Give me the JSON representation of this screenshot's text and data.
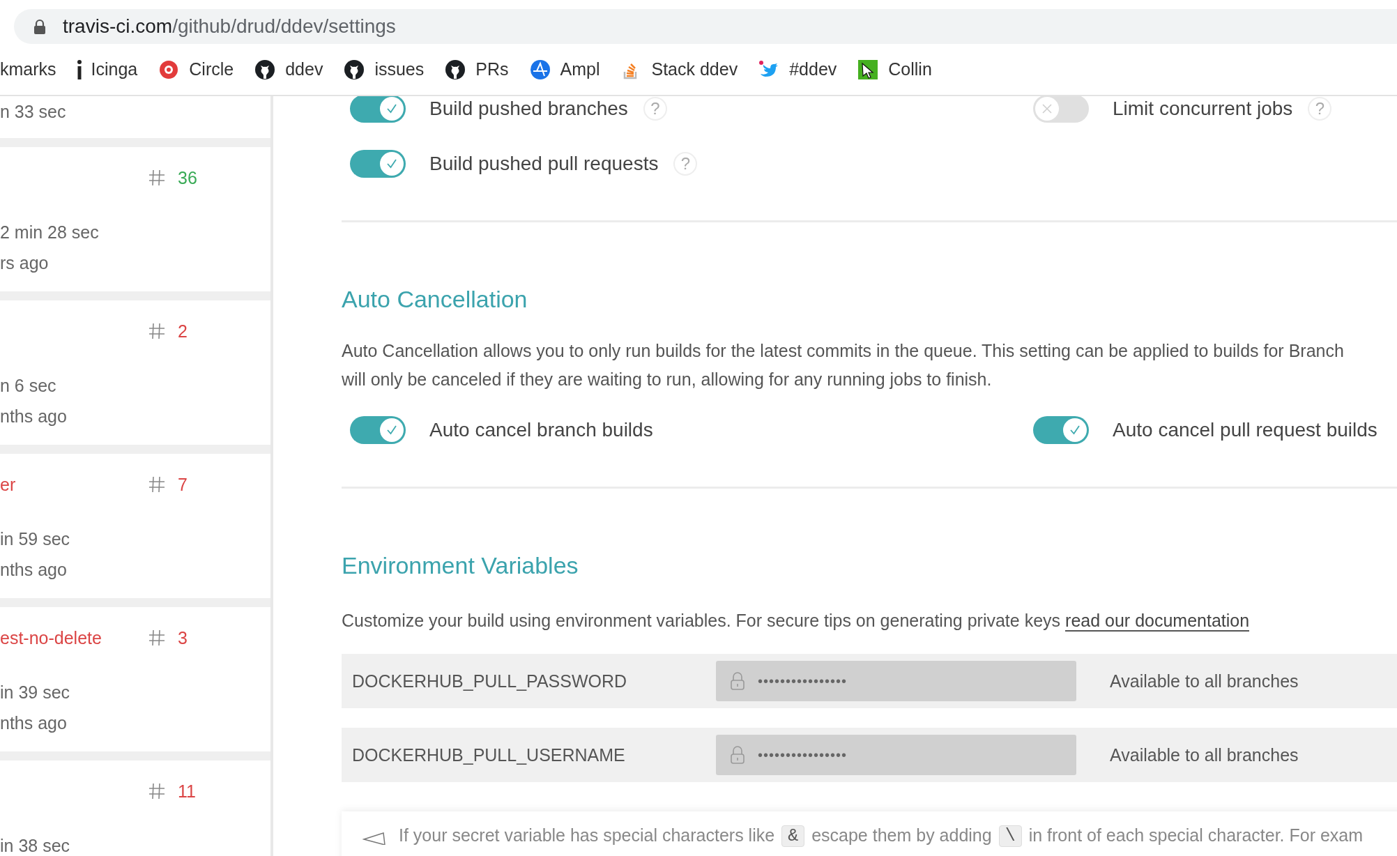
{
  "browser": {
    "url_host": "travis-ci.com",
    "url_path": "/github/drud/ddev/settings",
    "bookmarks": [
      {
        "kind": "none",
        "label": "kmarks"
      },
      {
        "kind": "info",
        "label": "Icinga"
      },
      {
        "kind": "ring",
        "label": "Circle"
      },
      {
        "kind": "cat",
        "label": "ddev"
      },
      {
        "kind": "cat",
        "label": "issues"
      },
      {
        "kind": "cat",
        "label": "PRs"
      },
      {
        "kind": "wave",
        "label": "Ampl"
      },
      {
        "kind": "stack",
        "label": "Stack ddev"
      },
      {
        "kind": "bird",
        "label": "#ddev"
      },
      {
        "kind": "cursor",
        "label": "Collin"
      }
    ]
  },
  "sidebar": {
    "builds": [
      {
        "duration": "n 33 sec"
      },
      {
        "color": "#39aa56",
        "number": "36",
        "duration": "2 min 28 sec",
        "age": "rs ago"
      },
      {
        "color": "#db4545",
        "number": "2",
        "duration": "n 6 sec",
        "age": "nths ago"
      },
      {
        "color": "#db4545",
        "branch": "er",
        "number": "7",
        "duration": "in 59 sec",
        "age": "nths ago"
      },
      {
        "color": "#db4545",
        "branch": "est-no-delete",
        "number": "3",
        "duration": "in 39 sec",
        "age": "nths ago"
      },
      {
        "color": "#db4545",
        "number": "11",
        "duration": "in 38 sec"
      }
    ]
  },
  "general": {
    "left": [
      {
        "label": "Build pushed branches",
        "on": true,
        "help": "?"
      },
      {
        "label": "Build pushed pull requests",
        "on": true,
        "help": "?"
      }
    ],
    "right": [
      {
        "label": "Limit concurrent jobs",
        "on": false,
        "help": "?"
      }
    ]
  },
  "auto_cancellation": {
    "title": "Auto Cancellation",
    "description_lines": [
      "Auto Cancellation allows you to only run builds for the latest commits in the queue. This setting can be applied to builds for Branch",
      "will only be canceled if they are waiting to run, allowing for any running jobs to finish."
    ],
    "left": [
      {
        "label": "Auto cancel branch builds",
        "on": true
      }
    ],
    "right": [
      {
        "label": "Auto cancel pull request builds",
        "on": true
      }
    ]
  },
  "environment_variables": {
    "title": "Environment Variables",
    "description": "Customize your build using environment variables. For secure tips on generating private keys",
    "link": "read our documentation",
    "rows": [
      {
        "name": "DOCKERHUB_PULL_PASSWORD",
        "value": "••••••••••••••••",
        "scope": "Available to all branches"
      },
      {
        "name": "DOCKERHUB_PULL_USERNAME",
        "value": "••••••••••••••••",
        "scope": "Available to all branches"
      }
    ],
    "note": [
      {
        "kind": "text",
        "text": "If your secret variable has special characters like"
      },
      {
        "kind": "code",
        "text": "&"
      },
      {
        "kind": "text",
        "text": "escape them by adding"
      },
      {
        "kind": "code",
        "text": "\\"
      },
      {
        "kind": "text",
        "text": "in front of each special character. For exam"
      }
    ]
  }
}
